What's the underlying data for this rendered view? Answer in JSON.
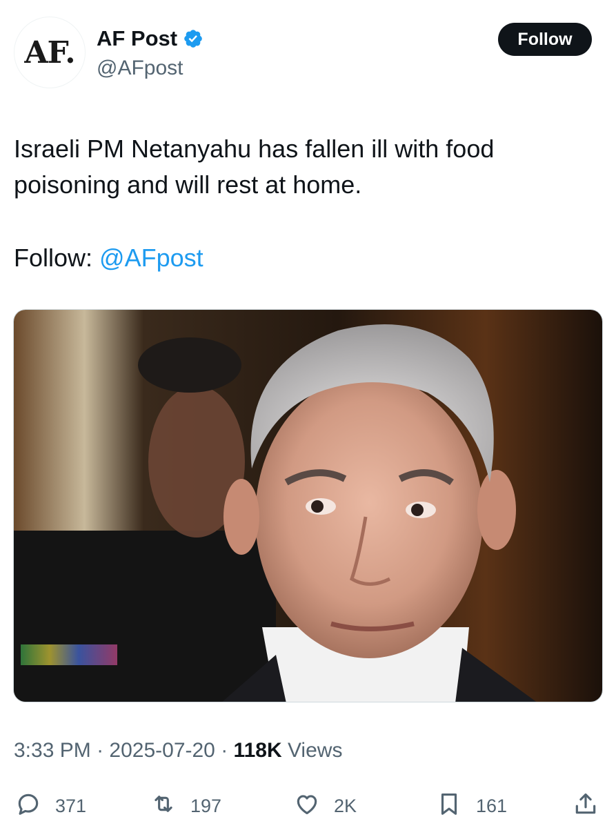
{
  "author": {
    "avatar_text": "AF.",
    "display_name": "AF Post",
    "handle": "@AFpost",
    "verified_icon": "verified-badge-icon",
    "verified_color": "#1d9bf0"
  },
  "follow_button": {
    "label": "Follow"
  },
  "tweet": {
    "text_lines": [
      "Israeli PM Netanyahu has fallen ill with food",
      "poisoning and will rest at home."
    ],
    "follow_prefix": "Follow: ",
    "follow_mention": "@AFpost",
    "mention_color": "#1d9bf0"
  },
  "meta": {
    "time": "3:33 PM",
    "separator": " · ",
    "date": "2025-07-20",
    "views_count": "118K",
    "views_label": " Views"
  },
  "actions": {
    "reply": {
      "icon": "reply-icon",
      "count": "371"
    },
    "retweet": {
      "icon": "retweet-icon",
      "count": "197"
    },
    "like": {
      "icon": "heart-icon",
      "count": "2K"
    },
    "bookmark": {
      "icon": "bookmark-icon",
      "count": "161"
    },
    "share": {
      "icon": "share-icon"
    }
  },
  "colors": {
    "text_primary": "#0f1419",
    "text_secondary": "#536471",
    "accent": "#1d9bf0",
    "button_bg": "#0f1419"
  }
}
